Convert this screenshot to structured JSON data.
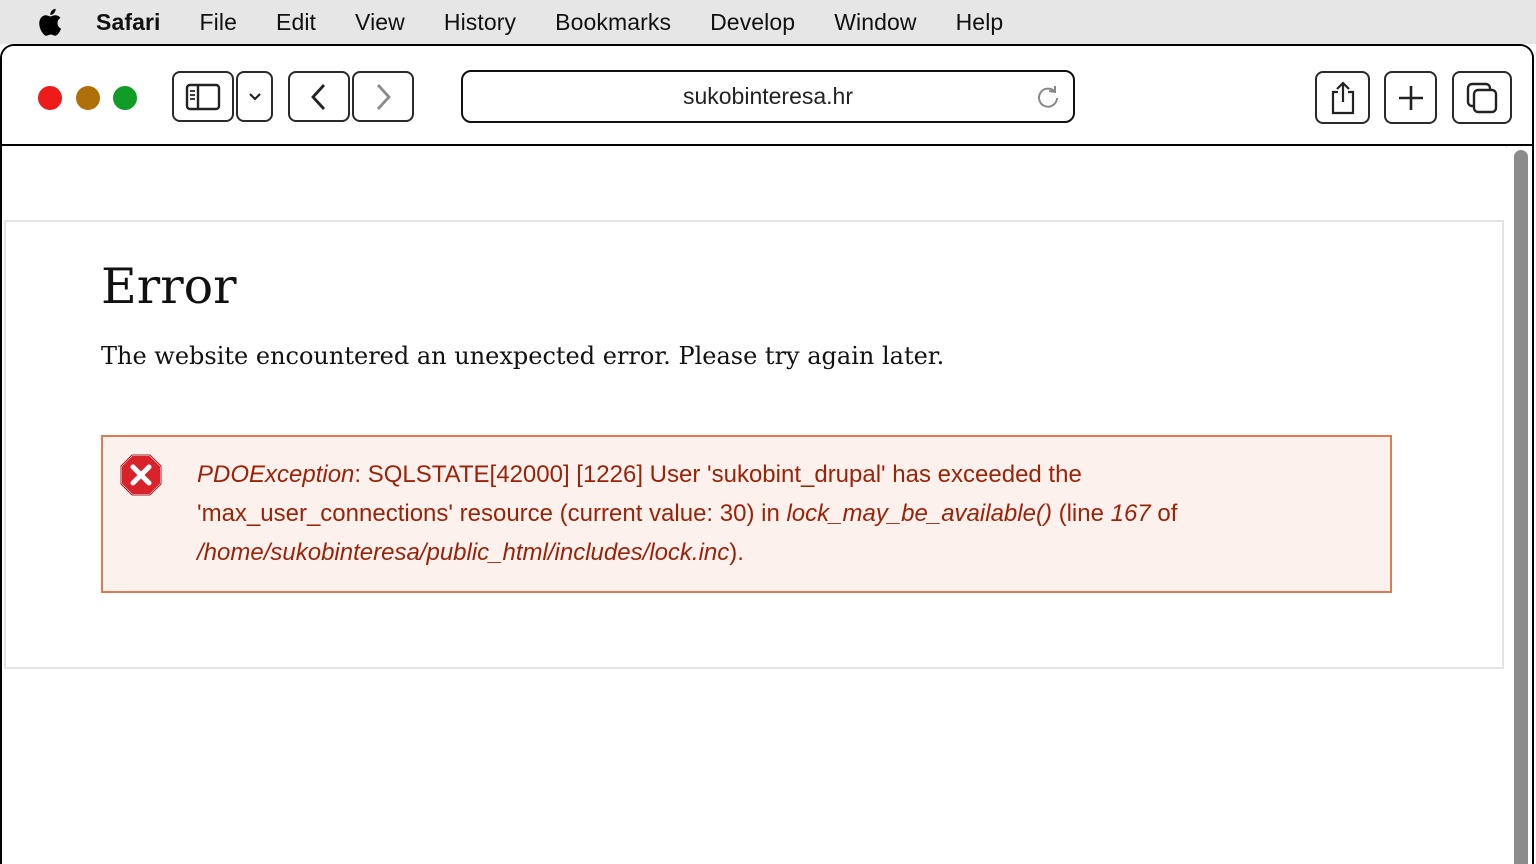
{
  "menubar": {
    "apple_icon": "apple-logo-icon",
    "app_name": "Safari",
    "items": [
      "File",
      "Edit",
      "View",
      "History",
      "Bookmarks",
      "Develop",
      "Window",
      "Help"
    ]
  },
  "toolbar": {
    "url": "sukobinteresa.hr",
    "icons": {
      "sidebar": "sidebar-icon",
      "sidebar_menu": "chevron-down-icon",
      "back": "chevron-left-icon",
      "forward": "chevron-right-icon",
      "reload": "reload-icon",
      "share": "share-icon",
      "new_tab": "plus-icon",
      "tab_overview": "tabs-icon"
    }
  },
  "page": {
    "title": "Error",
    "description": "The website encountered an unexpected error. Please try again later.",
    "message": {
      "exception": "PDOException",
      "text1": ": SQLSTATE[42000] [1226] User 'sukobint_drupal' has exceeded the 'max_user_connections' resource (current value: 30) in ",
      "function": "lock_may_be_available()",
      "text2": " (line ",
      "line": "167",
      "text3": " of ",
      "file": "/home/sukobinteresa/public_html/includes/lock.inc",
      "text4": ")."
    }
  },
  "colors": {
    "error_text": "#9a2308",
    "error_border": "#e07a53",
    "error_bg": "#fdf1ee",
    "traffic_red": "#ee1b1b",
    "traffic_yellow": "#b07009",
    "traffic_green": "#119c28"
  }
}
